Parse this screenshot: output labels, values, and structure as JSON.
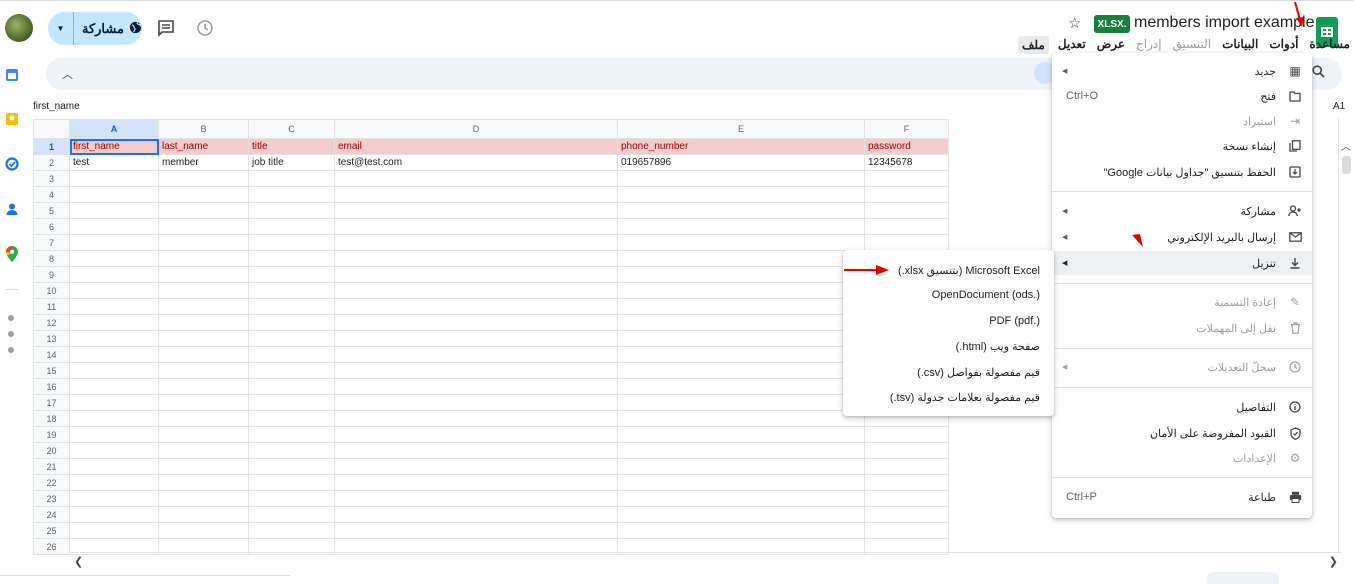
{
  "header": {
    "title": "members import example",
    "badge": "XLSX.",
    "share_label": "مشاركة"
  },
  "menubar": [
    "ملف",
    "تعديل",
    "عرض",
    "إدراج",
    "التنسيق",
    "البيانات",
    "أدوات",
    "مساعدة"
  ],
  "formula_bar": {
    "cell_value": "first_name",
    "cell_ref": "A1"
  },
  "grid": {
    "columns": [
      "A",
      "B",
      "C",
      "D",
      "E",
      "F"
    ],
    "header_row": [
      "first_name",
      "last_name",
      "title",
      "email",
      "phone_number",
      "password"
    ],
    "data_row": [
      "test",
      "member",
      "job title",
      "test@test.com",
      "019657896",
      "12345678"
    ],
    "row_numbers": [
      "1",
      "2",
      "3",
      "4",
      "5",
      "6",
      "7",
      "8",
      "9",
      "10",
      "11",
      "12",
      "13",
      "14",
      "15",
      "16",
      "17",
      "18",
      "19",
      "20",
      "21",
      "22",
      "23",
      "24",
      "25",
      "26"
    ]
  },
  "file_menu": {
    "new": "جديد",
    "open": "فتح",
    "open_shortcut": "Ctrl+O",
    "import": "استيراد",
    "make_copy": "إنشاء نسخة",
    "save_as_sheets": "الحفظ بتنسيق \"جداول بيانات Google\"",
    "share": "مشاركة",
    "email": "إرسال بالبريد الإلكتروني",
    "download": "تنزيل",
    "rename": "إعادة التسمية",
    "move_to_trash": "نقل إلى المهملات",
    "version_history": "سجلّ التعديلات",
    "details": "التفاصيل",
    "security_limits": "القيود المفروضة على الأمان",
    "settings": "الإعدادات",
    "print": "طباعة",
    "print_shortcut": "Ctrl+P"
  },
  "download_menu": [
    "Microsoft Excel (بتنسيق xlsx.)",
    "OpenDocument (ods.)",
    "PDF (pdf.)",
    "صفحة ويب (html.)",
    "قيم مفصولة بفواصل (csv.)",
    "قيم مفصولة بعلامات جدولة (tsv.)"
  ],
  "colors": {
    "accent": "#1a73e8",
    "header_fill": "#f4cccc",
    "header_text": "#990000",
    "annotation": "#e60000"
  }
}
